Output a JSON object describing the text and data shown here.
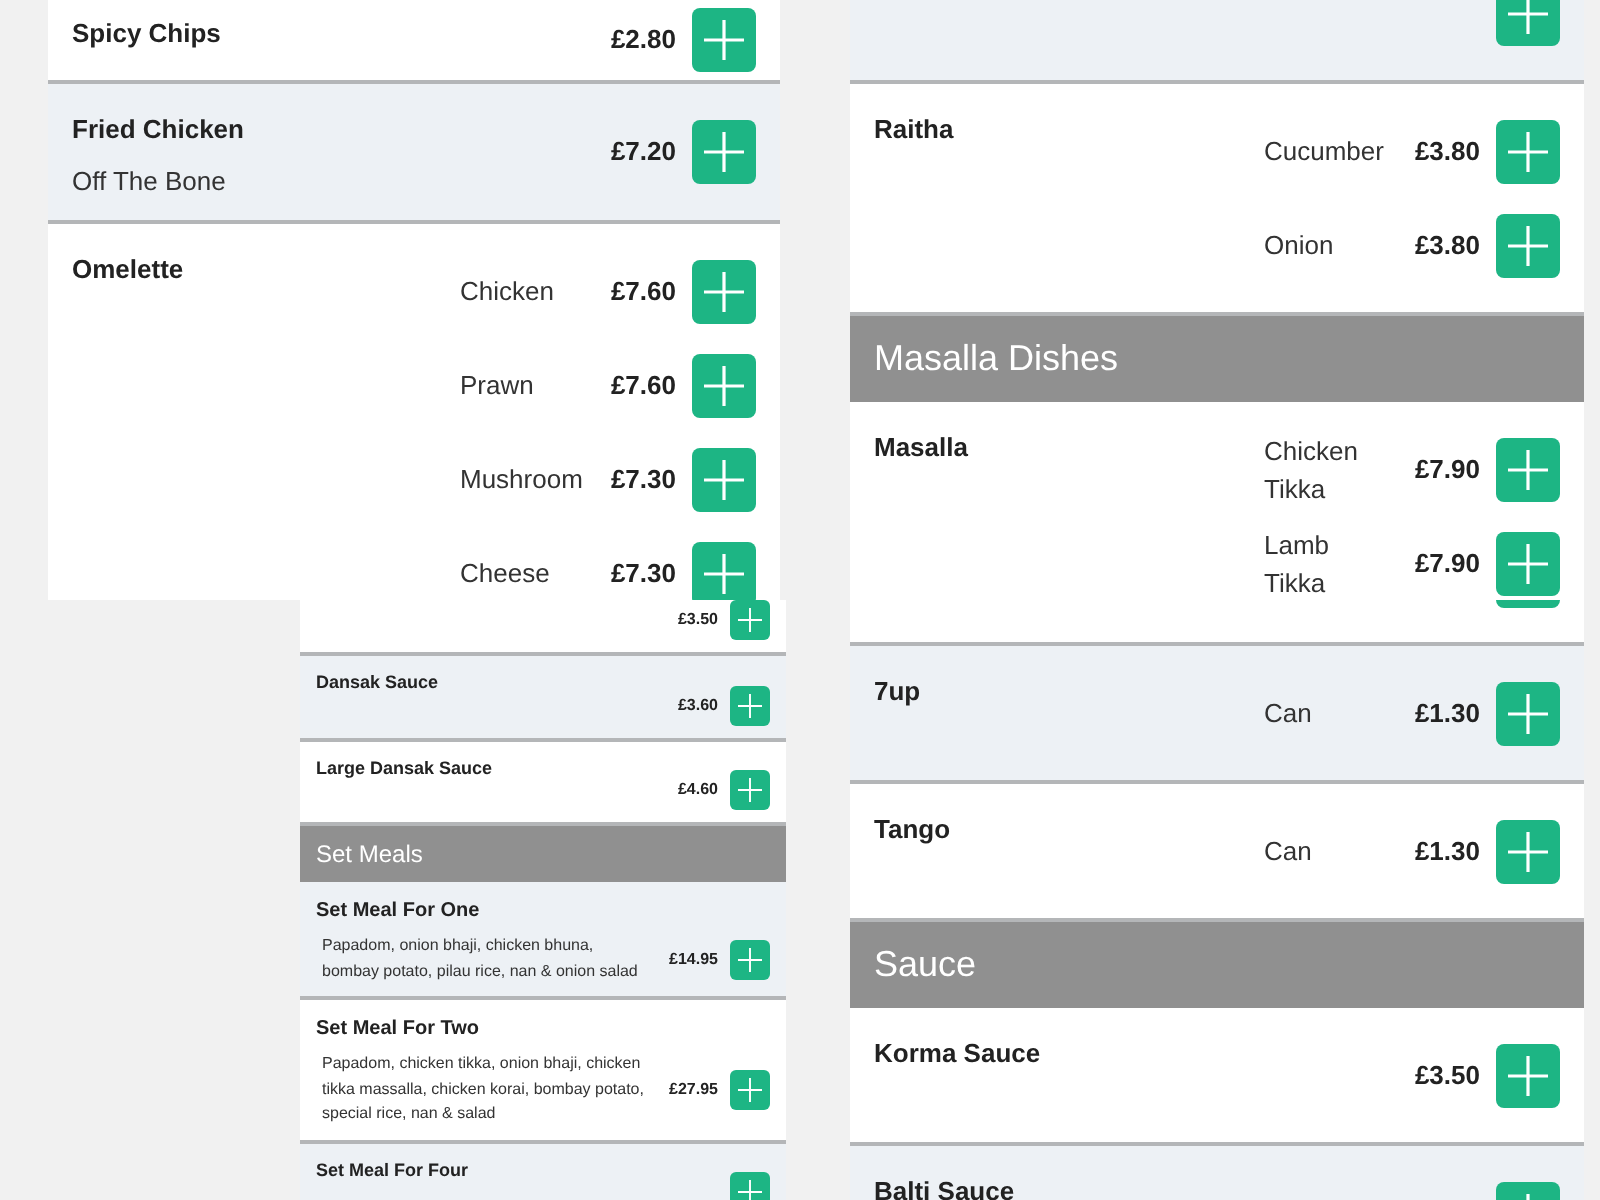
{
  "panels": [
    {
      "kind": "regular",
      "rows": [
        {
          "kind": "item",
          "name": "Spicy Chips",
          "shaded": false,
          "variants": [
            {
              "price": "£2.80"
            }
          ]
        },
        {
          "kind": "item",
          "name": "Fried Chicken",
          "description": "Off The Bone",
          "shaded": true,
          "variants": [
            {
              "price": "£7.20"
            }
          ]
        },
        {
          "kind": "item",
          "name": "Omelette",
          "shaded": false,
          "variants": [
            {
              "label": "Chicken",
              "price": "£7.60"
            },
            {
              "label": "Prawn",
              "price": "£7.60"
            },
            {
              "label": "Mushroom",
              "price": "£7.30"
            },
            {
              "label": "Cheese",
              "price": "£7.30"
            }
          ]
        }
      ]
    },
    {
      "kind": "regular",
      "rows": [
        {
          "kind": "item",
          "shaded": true
        },
        {
          "kind": "item",
          "name": "Raitha",
          "shaded": false,
          "variants": [
            {
              "label": "Cucumber",
              "price": "£3.80"
            },
            {
              "label": "Onion",
              "price": "£3.80"
            }
          ]
        },
        {
          "kind": "header",
          "title": "Masalla Dishes"
        },
        {
          "kind": "item",
          "name": "Masalla",
          "shaded": false,
          "variants": [
            {
              "label": "Chicken Tikka",
              "price": "£7.90"
            },
            {
              "label": "Lamb Tikka",
              "price": "£7.90"
            }
          ]
        }
      ]
    },
    {
      "kind": "compact",
      "rows": [
        {
          "kind": "item",
          "shaded": false,
          "variants": [
            {
              "price": "£3.50"
            }
          ]
        },
        {
          "kind": "item",
          "name": "Dansak Sauce",
          "shaded": true,
          "variants": [
            {
              "price": "£3.60"
            }
          ]
        },
        {
          "kind": "item",
          "name": "Large Dansak Sauce",
          "shaded": false,
          "variants": [
            {
              "price": "£4.60"
            }
          ]
        },
        {
          "kind": "header",
          "title": "Set Meals"
        },
        {
          "kind": "item",
          "name": "Set Meal For One",
          "description": "Papadom, onion bhaji, chicken bhuna, bombay potato, pilau rice, nan & onion salad",
          "shaded": true,
          "variants": [
            {
              "price": "£14.95"
            }
          ]
        },
        {
          "kind": "item",
          "name": "Set Meal For Two",
          "description": "Papadom, chicken tikka, onion bhaji, chicken tikka massalla, chicken korai, bombay potato, special rice, nan & salad",
          "shaded": false,
          "variants": [
            {
              "price": "£27.95"
            }
          ]
        },
        {
          "kind": "item",
          "name": "Set Meal For Four",
          "shaded": true
        }
      ]
    },
    {
      "kind": "regular",
      "rows": [
        {
          "kind": "item",
          "shaded": false
        },
        {
          "kind": "item",
          "name": "7up",
          "shaded": true,
          "variants": [
            {
              "label": "Can",
              "price": "£1.30"
            }
          ]
        },
        {
          "kind": "item",
          "name": "Tango",
          "shaded": false,
          "variants": [
            {
              "label": "Can",
              "price": "£1.30"
            }
          ]
        },
        {
          "kind": "header",
          "title": "Sauce"
        },
        {
          "kind": "item",
          "name": "Korma Sauce",
          "shaded": false,
          "variants": [
            {
              "price": "£3.50"
            }
          ]
        },
        {
          "kind": "item",
          "name": "Balti Sauce",
          "shaded": true
        }
      ]
    }
  ]
}
